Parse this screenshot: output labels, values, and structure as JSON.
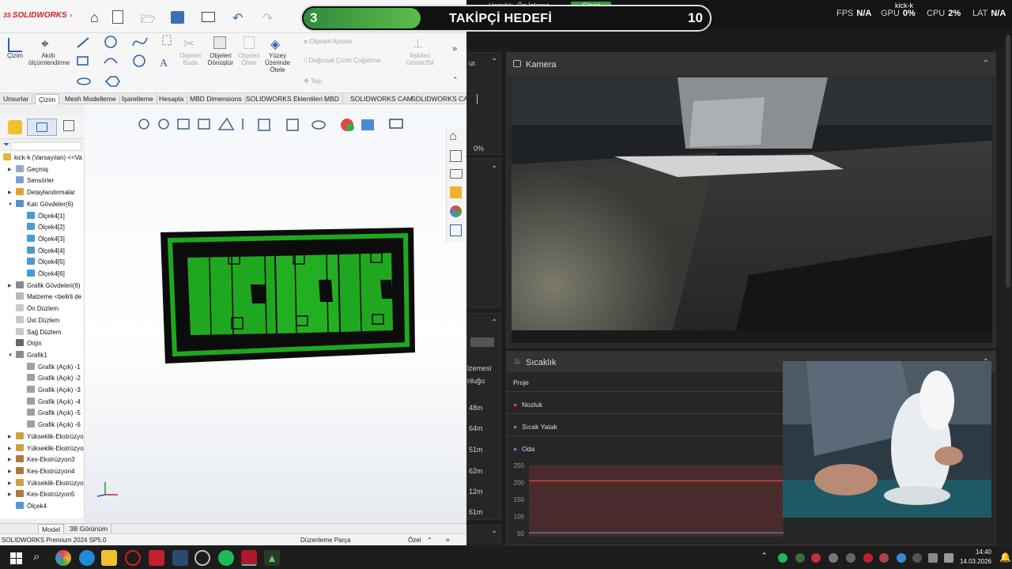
{
  "dark_app": {
    "stats": {
      "fps_label": "FPS",
      "fps_value": "N/A",
      "gpu_label": "GPU",
      "gpu_value": "0%",
      "cpu_label": "CPU",
      "cpu_value": "2%",
      "lat_label": "LAT",
      "lat_value": "N/A",
      "user": "kick-k"
    },
    "top_tabs": [
      "Hazırlık",
      "Ön İzleme",
      "Cihaz"
    ],
    "left_col": {
      "item1": "ur.",
      "percent": "0%",
      "item2": "lzemesi",
      "item3": "nluğu",
      "times": [
        "48m",
        "64m",
        "51m",
        "62m",
        "12m",
        "61m"
      ]
    },
    "camera": {
      "title": "Kamera"
    },
    "temperature": {
      "title": "Sıcaklık",
      "col_label": "Proje",
      "rows": [
        {
          "name": "Nozluk",
          "color": "#e04848"
        },
        {
          "name": "Sıcak Yatak",
          "color": "#3d8ee0"
        },
        {
          "name": "Oda",
          "color": "#9a5ee0"
        }
      ],
      "y_ticks": [
        "250",
        "200",
        "150",
        "100",
        "50"
      ],
      "line_value": 205,
      "line2_value": 52,
      "line_color": "#e04848"
    }
  },
  "overlay": {
    "goal_current": "3",
    "goal_title": "TAKİPÇİ HEDEFİ",
    "goal_target": "10",
    "progress_fraction": 0.3
  },
  "solidworks": {
    "logo": "SOLIDWORKS",
    "ribbon": {
      "cizim": "Çizim",
      "akilli": "Akıllı ölçümlendirme",
      "budaLbl": "Objeleri Buda",
      "donusturLbl": "Objeleri Dönüştür",
      "otele": "Objeleri Ötele",
      "yuzey": "Yüzey Üzerinde Ötele",
      "aynala": "Objeleri Aynala",
      "dogrusal": "Doğrusal Çizim Çoğaltma",
      "tasi": "Taşı",
      "iliskiler": "İlişkileri Göster/Sil"
    },
    "tabs": [
      "Unsurlar",
      "Çizim",
      "Mesh Modelleme",
      "İşaretleme",
      "Hesapla",
      "MBD Dimensions",
      "SOLIDWORKS Eklentileri",
      "MBD",
      "SOLIDWORKS CAM",
      "SOLIDWORKS CA..."
    ],
    "active_tab": "Çizim",
    "tree": [
      {
        "label": "kick-k (Varsayılan) <<Va",
        "level": 0,
        "color": "#e2b43a",
        "arrow": ""
      },
      {
        "label": "Geçmiş",
        "level": 1,
        "color": "#9aa9c2",
        "arrow": "▶"
      },
      {
        "label": "Sensörler",
        "level": 1,
        "color": "#7aa2d8",
        "arrow": ""
      },
      {
        "label": "Detaylandırmalar",
        "level": 1,
        "color": "#e0a030",
        "arrow": "▶"
      },
      {
        "label": "Katı Gövdeler(6)",
        "level": 1,
        "color": "#5a8ec8",
        "arrow": "▼"
      },
      {
        "label": "Ölçek4[1]",
        "level": 2,
        "color": "#4a9ad8",
        "arrow": ""
      },
      {
        "label": "Ölçek4[2]",
        "level": 2,
        "color": "#4a9ad8",
        "arrow": ""
      },
      {
        "label": "Ölçek4[3]",
        "level": 2,
        "color": "#4a9ad8",
        "arrow": ""
      },
      {
        "label": "Ölçek4[4]",
        "level": 2,
        "color": "#4a9ad8",
        "arrow": ""
      },
      {
        "label": "Ölçek4[5]",
        "level": 2,
        "color": "#4a9ad8",
        "arrow": ""
      },
      {
        "label": "Ölçek4[6]",
        "level": 2,
        "color": "#4a9ad8",
        "arrow": ""
      },
      {
        "label": "Grafik Gövdeleri(6)",
        "level": 1,
        "color": "#8a8a8a",
        "arrow": "▶"
      },
      {
        "label": "Malzeme <belirli de",
        "level": 1,
        "color": "#b8b8b8",
        "arrow": ""
      },
      {
        "label": "Ön Düzlem",
        "level": 1,
        "color": "#c8c8c8",
        "arrow": ""
      },
      {
        "label": "Üst Düzlem",
        "level": 1,
        "color": "#c8c8c8",
        "arrow": ""
      },
      {
        "label": "Sağ Düzlem",
        "level": 1,
        "color": "#c8c8c8",
        "arrow": ""
      },
      {
        "label": "Orijin",
        "level": 1,
        "color": "#666666",
        "arrow": ""
      },
      {
        "label": "Grafik1",
        "level": 1,
        "color": "#8a8a8a",
        "arrow": "▼"
      },
      {
        "label": "Grafik (Açık) -1",
        "level": 2,
        "color": "#a0a0a0",
        "arrow": ""
      },
      {
        "label": "Grafik (Açık) -2",
        "level": 2,
        "color": "#a0a0a0",
        "arrow": ""
      },
      {
        "label": "Grafik (Açık) -3",
        "level": 2,
        "color": "#a0a0a0",
        "arrow": ""
      },
      {
        "label": "Grafik (Açık) -4",
        "level": 2,
        "color": "#a0a0a0",
        "arrow": ""
      },
      {
        "label": "Grafik (Açık) -5",
        "level": 2,
        "color": "#a0a0a0",
        "arrow": ""
      },
      {
        "label": "Grafik (Açık) -6",
        "level": 2,
        "color": "#a0a0a0",
        "arrow": ""
      },
      {
        "label": "Yükseklik-Ekstrüzyon",
        "level": 1,
        "color": "#d0a040",
        "arrow": "▶"
      },
      {
        "label": "Yükseklik-Ekstrüzyon",
        "level": 1,
        "color": "#d0a040",
        "arrow": "▶"
      },
      {
        "label": "Kes-Ekstrüzyon3",
        "level": 1,
        "color": "#b07840",
        "arrow": "▶"
      },
      {
        "label": "Kes-Ekstrüzyon4",
        "level": 1,
        "color": "#b07840",
        "arrow": "▶"
      },
      {
        "label": "Yükseklik-Ekstrüzyon",
        "level": 1,
        "color": "#d0a040",
        "arrow": "▶"
      },
      {
        "label": "Kes-Ekstrüzyon5",
        "level": 1,
        "color": "#b07840",
        "arrow": "▶"
      },
      {
        "label": "Ölçek4",
        "level": 1,
        "color": "#4a9ad8",
        "arrow": ""
      }
    ],
    "bottom_tabs": [
      "Model",
      "3B Görünüm"
    ],
    "status": {
      "product": "SOLIDWORKS Premium 2024 SP5.0",
      "mode": "Düzenleme Parça",
      "units": "Özel"
    },
    "model_color": "#1fa81f"
  },
  "taskbar": {
    "time": "14:40",
    "date": "14.03.2026"
  }
}
